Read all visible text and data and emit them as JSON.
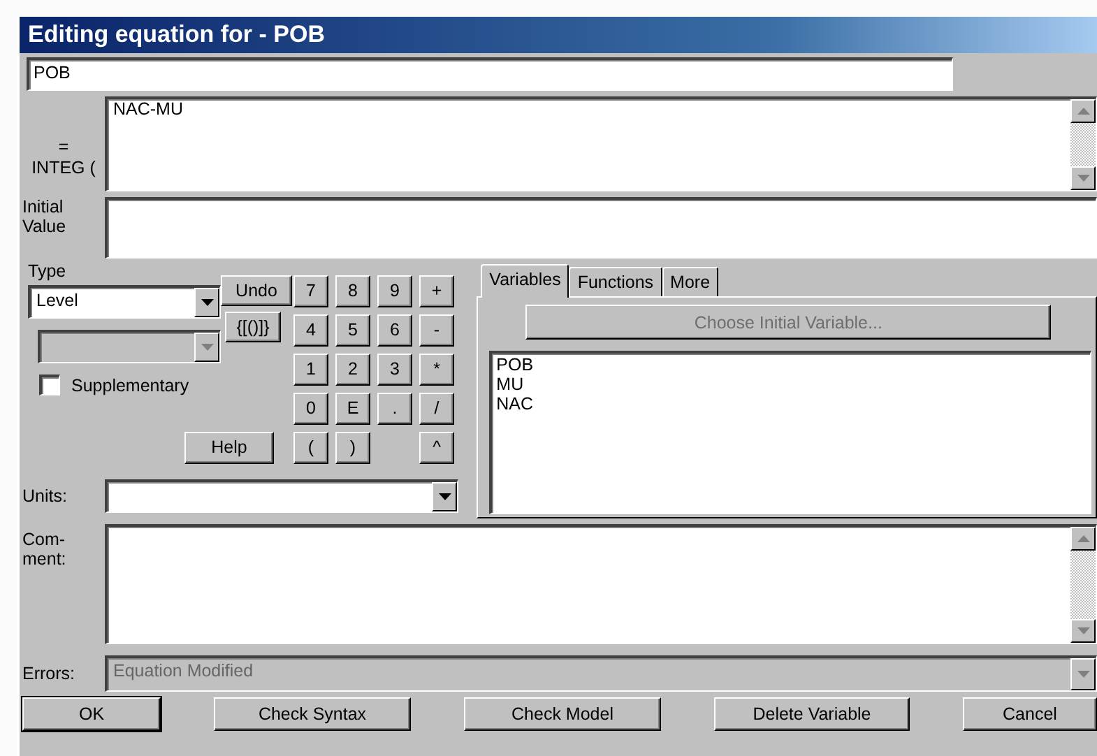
{
  "window": {
    "title": "Editing equation for - POB"
  },
  "name_field": {
    "value": "POB"
  },
  "equation": {
    "label_lines": [
      "=",
      "INTEG ("
    ],
    "value": "NAC-MU"
  },
  "initial_value": {
    "label_lines": [
      "Initial",
      "Value"
    ]
  },
  "type": {
    "label": "Type",
    "value": "Level",
    "subtype_disabled": true
  },
  "supplementary": {
    "label": "Supplementary",
    "checked": false
  },
  "side_buttons": [
    {
      "label": "Undo"
    },
    {
      "label": "{[()]}"
    }
  ],
  "keypad": [
    {
      "label": "7"
    },
    {
      "label": "8"
    },
    {
      "label": "9"
    },
    {
      "label": "+"
    },
    {
      "label": "4"
    },
    {
      "label": "5"
    },
    {
      "label": "6"
    },
    {
      "label": "-"
    },
    {
      "label": "1"
    },
    {
      "label": "2"
    },
    {
      "label": "3"
    },
    {
      "label": "*"
    },
    {
      "label": "0"
    },
    {
      "label": "E"
    },
    {
      "label": "."
    },
    {
      "label": "/"
    },
    {
      "label": "("
    },
    {
      "label": ")"
    },
    {
      "kind": "gap"
    },
    {
      "label": "^"
    }
  ],
  "help_button": {
    "label": "Help"
  },
  "tabs": [
    {
      "label": "Variables",
      "selected": true
    },
    {
      "label": "Functions",
      "selected": false
    },
    {
      "label": "More",
      "selected": false
    }
  ],
  "choose_button": {
    "label": "Choose Initial Variable...",
    "disabled": true
  },
  "variables": [
    "POB",
    "MU",
    "NAC"
  ],
  "units": {
    "label": "Units:"
  },
  "comment": {
    "label_lines": [
      "Com-",
      "ment:"
    ]
  },
  "errors": {
    "label": "Errors:",
    "value": "Equation Modified",
    "disabled": true
  },
  "buttons": [
    {
      "label": "OK",
      "default": true
    },
    {
      "label": "Check Syntax",
      "default": false
    },
    {
      "label": "Check Model",
      "default": false
    },
    {
      "label": "Delete Variable",
      "default": false
    },
    {
      "label": "Cancel",
      "default": false
    }
  ]
}
